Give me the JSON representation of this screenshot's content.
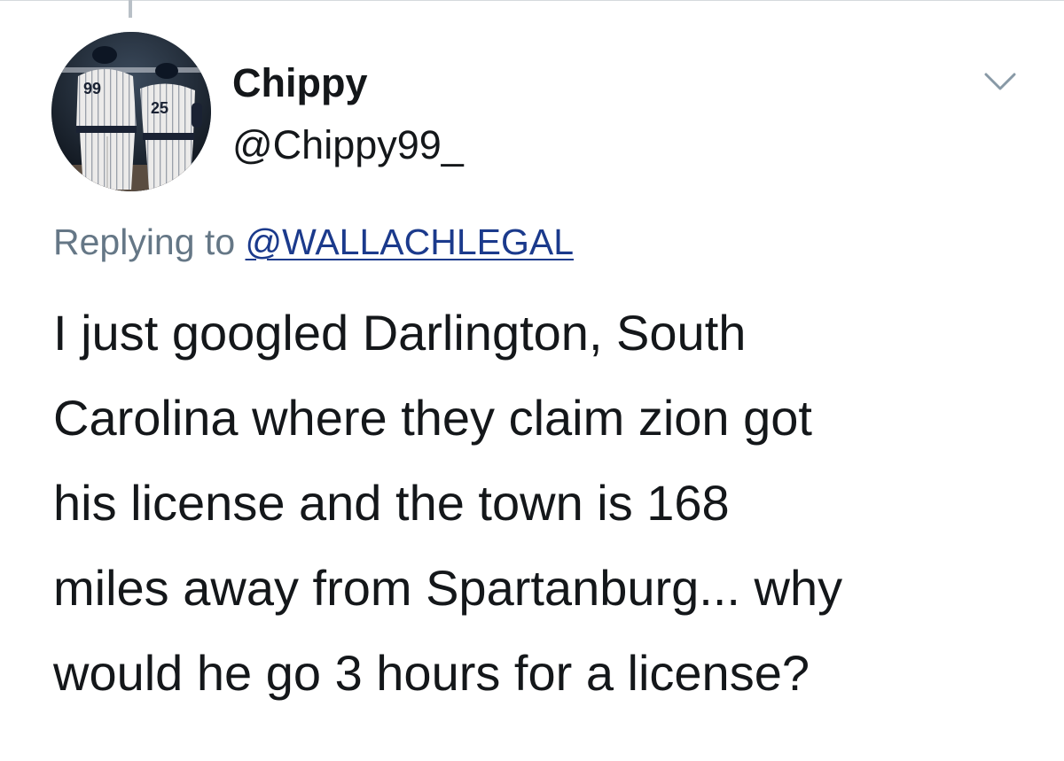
{
  "tweet": {
    "author": {
      "display_name": "Chippy",
      "handle": "@Chippy99_",
      "avatar_icon": "profile-photo-two-baseball-players",
      "avatar_numbers": [
        "99",
        "25"
      ]
    },
    "menu_icon": "chevron-down-icon",
    "reply_context": {
      "prefix": "Replying to ",
      "mention": "@WALLACHLEGAL"
    },
    "text_lines": [
      "I just googled Darlington, South",
      "Carolina where they claim zion got",
      "his license and the town is 168",
      "miles away from Spartanburg... why",
      "would he go 3 hours for a license?"
    ]
  },
  "colors": {
    "text": "#14171a",
    "muted": "#657786",
    "link": "#1b3a8c",
    "border": "#d5d9dd"
  }
}
